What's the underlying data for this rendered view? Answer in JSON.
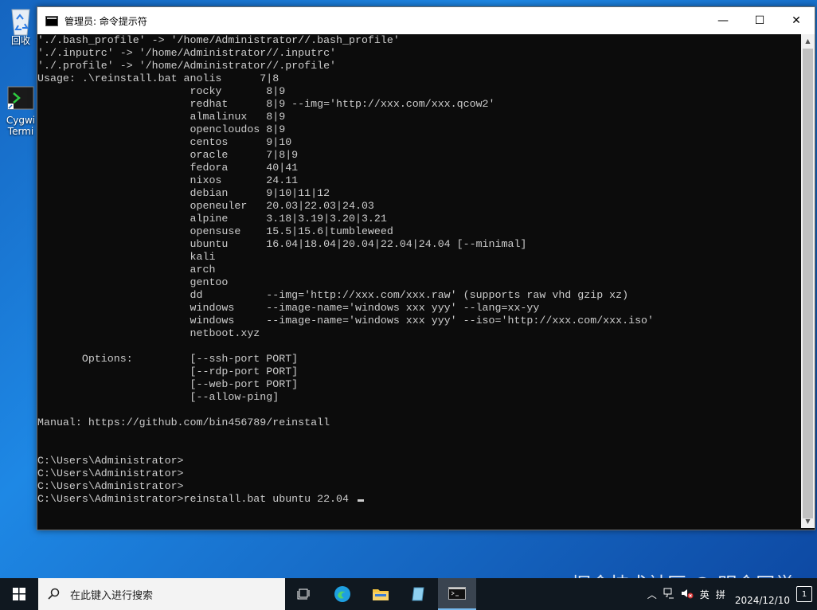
{
  "desktop": {
    "recycle_label": "回收",
    "cygwin_label_1": "Cygwi",
    "cygwin_label_2": "Termi"
  },
  "window": {
    "title": "管理员: 命令提示符",
    "minimize": "—",
    "maximize": "☐",
    "close": "✕"
  },
  "console": {
    "lines": [
      "'./.bash_profile' -> '/home/Administrator//.bash_profile'",
      "'./.inputrc' -> '/home/Administrator//.inputrc'",
      "'./.profile' -> '/home/Administrator//.profile'",
      "Usage: .\\reinstall.bat anolis      7|8",
      "                        rocky       8|9",
      "                        redhat      8|9 --img='http://xxx.com/xxx.qcow2'",
      "                        almalinux   8|9",
      "                        opencloudos 8|9",
      "                        centos      9|10",
      "                        oracle      7|8|9",
      "                        fedora      40|41",
      "                        nixos       24.11",
      "                        debian      9|10|11|12",
      "                        openeuler   20.03|22.03|24.03",
      "                        alpine      3.18|3.19|3.20|3.21",
      "                        opensuse    15.5|15.6|tumbleweed",
      "                        ubuntu      16.04|18.04|20.04|22.04|24.04 [--minimal]",
      "                        kali",
      "                        arch",
      "                        gentoo",
      "                        dd          --img='http://xxx.com/xxx.raw' (supports raw vhd gzip xz)",
      "                        windows     --image-name='windows xxx yyy' --lang=xx-yy",
      "                        windows     --image-name='windows xxx yyy' --iso='http://xxx.com/xxx.iso'",
      "                        netboot.xyz",
      "",
      "       Options:         [--ssh-port PORT]",
      "                        [--rdp-port PORT]",
      "                        [--web-port PORT]",
      "                        [--allow-ping]",
      "",
      "Manual: https://github.com/bin456789/reinstall",
      "",
      "",
      "C:\\Users\\Administrator>",
      "C:\\Users\\Administrator>",
      "C:\\Users\\Administrator>",
      "C:\\Users\\Administrator>reinstall.bat ubuntu 22.04 "
    ]
  },
  "watermark": "掘金技术社区 @ 明金同学",
  "taskbar": {
    "search_placeholder": "在此键入进行搜索",
    "tray_ime": "英",
    "tray_ime2": "拼",
    "date": "2024/12/10",
    "notifications": "1"
  }
}
